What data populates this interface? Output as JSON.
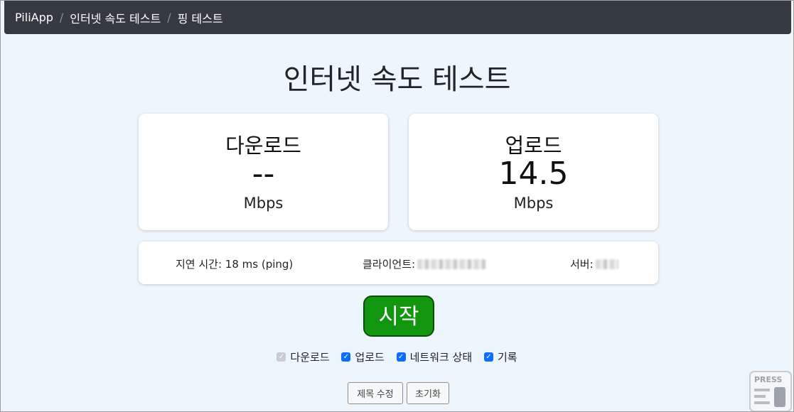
{
  "breadcrumb": {
    "home": "PiliApp",
    "section": "인터넷 속도 테스트",
    "current": "핑 테스트",
    "separator": "/"
  },
  "page_title": "인터넷 속도 테스트",
  "download": {
    "label": "다운로드",
    "value": "--",
    "unit": "Mbps"
  },
  "upload": {
    "label": "업로드",
    "value": "14.5",
    "unit": "Mbps"
  },
  "info": {
    "latency": "지연 시간: 18 ms (ping)",
    "client_label": "클라이언트:",
    "server_label": "서버:"
  },
  "start_button": "시작",
  "options": [
    {
      "label": "다운로드",
      "checked": true,
      "disabled": true
    },
    {
      "label": "업로드",
      "checked": true,
      "disabled": false
    },
    {
      "label": "네트워크 상태",
      "checked": true,
      "disabled": false
    },
    {
      "label": "기록",
      "checked": true,
      "disabled": false
    }
  ],
  "buttons": {
    "edit_title": "제목 수정",
    "reset": "초기화"
  },
  "watermark": "PRESS",
  "colors": {
    "navbar": "#343a40",
    "background": "#edf5fd",
    "start_button": "#12960f",
    "checkbox": "#0d6efd"
  }
}
